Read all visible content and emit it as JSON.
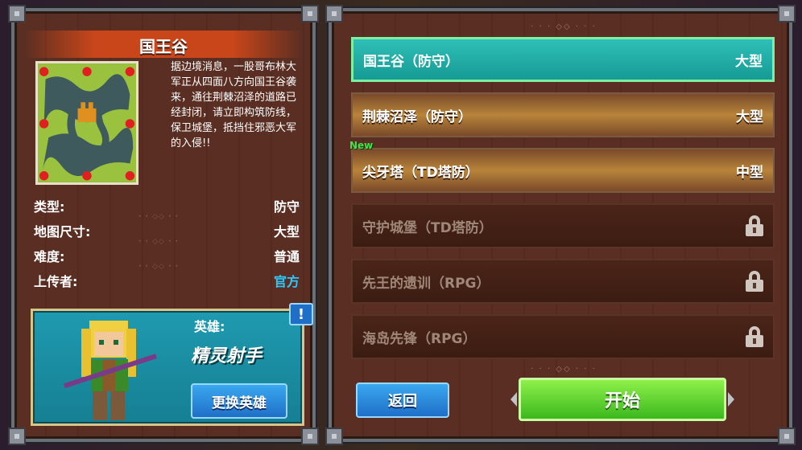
{
  "map_panel": {
    "title": "国王谷",
    "description": "据边境消息，一股哥布林大军正从四面八方向国王谷袭来，通往荆棘沼泽的道路已经封闭，请立即构筑防线，保卫城堡，抵挡住邪恶大军的入侵!!",
    "stats": [
      {
        "label": "类型:",
        "value": "防守"
      },
      {
        "label": "地图尺寸:",
        "value": "大型"
      },
      {
        "label": "难度:",
        "value": "普通"
      },
      {
        "label": "上传者:",
        "value": "官方"
      }
    ]
  },
  "hero": {
    "label": "英雄:",
    "name": "精灵射手",
    "change_button": "更换英雄",
    "info_badge": "!"
  },
  "levels": [
    {
      "name": "国王谷（防守）",
      "size": "大型",
      "state": "selected"
    },
    {
      "name": "荆棘沼泽（防守）",
      "size": "大型",
      "state": "available"
    },
    {
      "name": "尖牙塔（TD塔防）",
      "size": "中型",
      "state": "available",
      "tag": "New"
    },
    {
      "name": "守护城堡（TD塔防）",
      "size": "",
      "state": "locked",
      "icon": "lock-icon"
    },
    {
      "name": "先王的遗训（RPG）",
      "size": "",
      "state": "locked",
      "icon": "lock-icon"
    },
    {
      "name": "海岛先锋（RPG）",
      "size": "",
      "state": "locked",
      "icon": "lock-icon"
    }
  ],
  "buttons": {
    "back": "返回",
    "start": "开始"
  },
  "colors": {
    "selected": "#2ec0b8",
    "stat_blue": "#2ec8ff",
    "start_green": "#5fd62e",
    "button_blue": "#2a8ee0",
    "new_tag": "#4ae04a"
  }
}
